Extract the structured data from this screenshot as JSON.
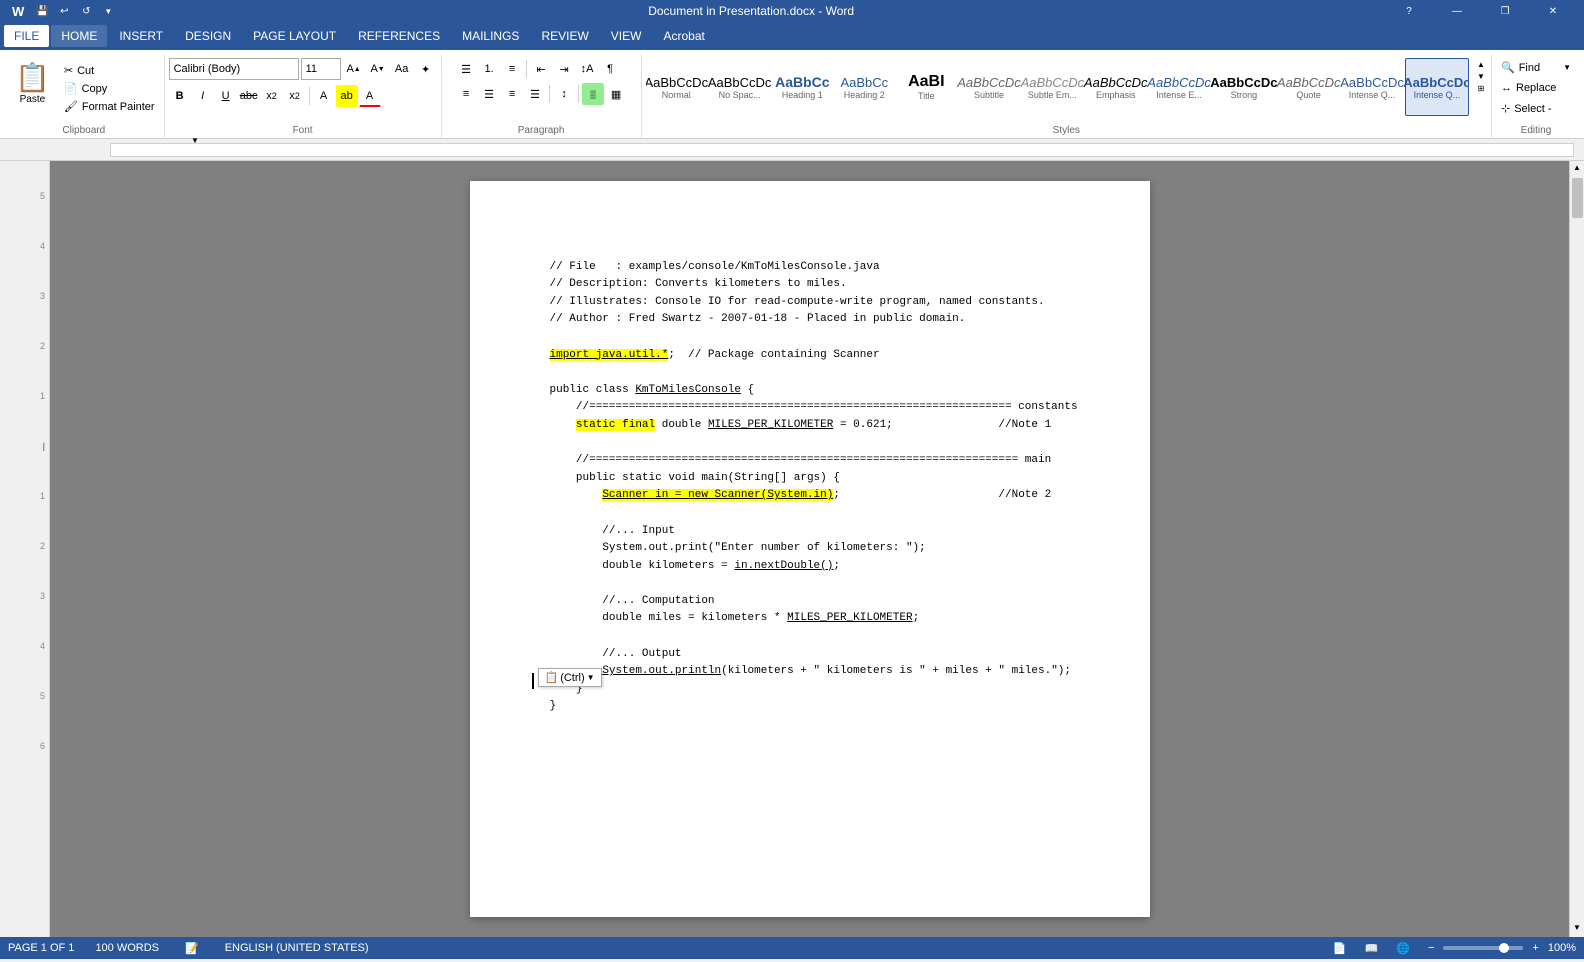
{
  "titleBar": {
    "title": "Document in Presentation.docx - Word",
    "icons": [
      "💾",
      "↩",
      "↺"
    ],
    "winBtns": [
      "?",
      "—",
      "❐",
      "✕"
    ]
  },
  "menuBar": {
    "items": [
      "FILE",
      "HOME",
      "INSERT",
      "DESIGN",
      "PAGE LAYOUT",
      "REFERENCES",
      "MAILINGS",
      "REVIEW",
      "VIEW",
      "Acrobat"
    ],
    "active": "HOME"
  },
  "ribbon": {
    "clipboard": {
      "label": "Clipboard",
      "paste": "Paste",
      "cut": "Cut",
      "copy": "Copy",
      "formatPainter": "Format Painter"
    },
    "font": {
      "label": "Font",
      "fontName": "Calibri (Body)",
      "fontSize": "11",
      "bold": "B",
      "italic": "I",
      "underline": "U",
      "strikethrough": "abc",
      "subscript": "x₂",
      "superscript": "x²"
    },
    "paragraph": {
      "label": "Paragraph"
    },
    "styles": {
      "label": "Styles",
      "items": [
        {
          "preview": "AaBbCcDc",
          "label": "Normal",
          "active": false
        },
        {
          "preview": "AaBbCcDc",
          "label": "No Spac...",
          "active": false
        },
        {
          "preview": "AaBbCc",
          "label": "Heading 1",
          "active": false
        },
        {
          "preview": "AaBbCc",
          "label": "Heading 2",
          "active": false
        },
        {
          "preview": "AaBI",
          "label": "Title",
          "active": false
        },
        {
          "preview": "AaBbCcDc",
          "label": "Subtitle",
          "active": false
        },
        {
          "preview": "AaBbCcDc",
          "label": "Subtle Em...",
          "active": false
        },
        {
          "preview": "AaBbCcDc",
          "label": "Emphasis",
          "active": false
        },
        {
          "preview": "AaBbCcDc",
          "label": "Intense E...",
          "active": false
        },
        {
          "preview": "AaBbCcDc",
          "label": "Strong",
          "active": false
        },
        {
          "preview": "AaBbCcDc",
          "label": "Quote",
          "active": false
        },
        {
          "preview": "AaBbCcDc",
          "label": "Intense Q...",
          "active": false
        },
        {
          "preview": "AaBbCcDc",
          "label": "Intense Q...",
          "active": true
        }
      ]
    },
    "editing": {
      "label": "Editing",
      "find": "Find",
      "replace": "Replace",
      "select": "Select -"
    }
  },
  "document": {
    "code": [
      "// File   : examples/console/KmToMilesConsole.java",
      "// Description: Converts kilometers to miles.",
      "// Illustrates: Console IO for read-compute-write program, named constants.",
      "// Author : Fred Swartz - 2007-01-18 - Placed in public domain.",
      "",
      "import java.util.*;  // Package containing Scanner",
      "",
      "public class KmToMilesConsole {",
      "    //================================================================ constants",
      "    static final double MILES_PER_KILOMETER = 0.621;                //Note 1",
      "",
      "    //================================================================= main",
      "    public static void main(String[] args) {",
      "        Scanner in = new Scanner(System.in);                        //Note 2",
      "",
      "        //... Input",
      "        System.out.print(\"Enter number of kilometers: \");",
      "        double kilometers = in.nextDouble();",
      "",
      "        //... Computation",
      "        double miles = kilometers * MILES_PER_KILOMETER;",
      "",
      "        //... Output",
      "        System.out.println(kilometers + \" kilometers is \" + miles + \" miles.\");",
      "    }",
      "}"
    ],
    "highlights": {
      "importLine": "import java.util.*;",
      "staticFinal": "static final",
      "scannerIn": "Scanner in = new Scanner(System.in);"
    },
    "underlines": [
      "import java.util.*;",
      "KmToMilesConsole",
      "Scanner in",
      "System.in",
      "in.nextDouble()",
      "MILES_PER_KILOMETER",
      "System.out.println"
    ]
  },
  "pasteTooltip": {
    "text": "(Ctrl)"
  },
  "statusBar": {
    "page": "PAGE 1 OF 1",
    "words": "100 WORDS",
    "language": "ENGLISH (UNITED STATES)",
    "zoom": "100%"
  }
}
